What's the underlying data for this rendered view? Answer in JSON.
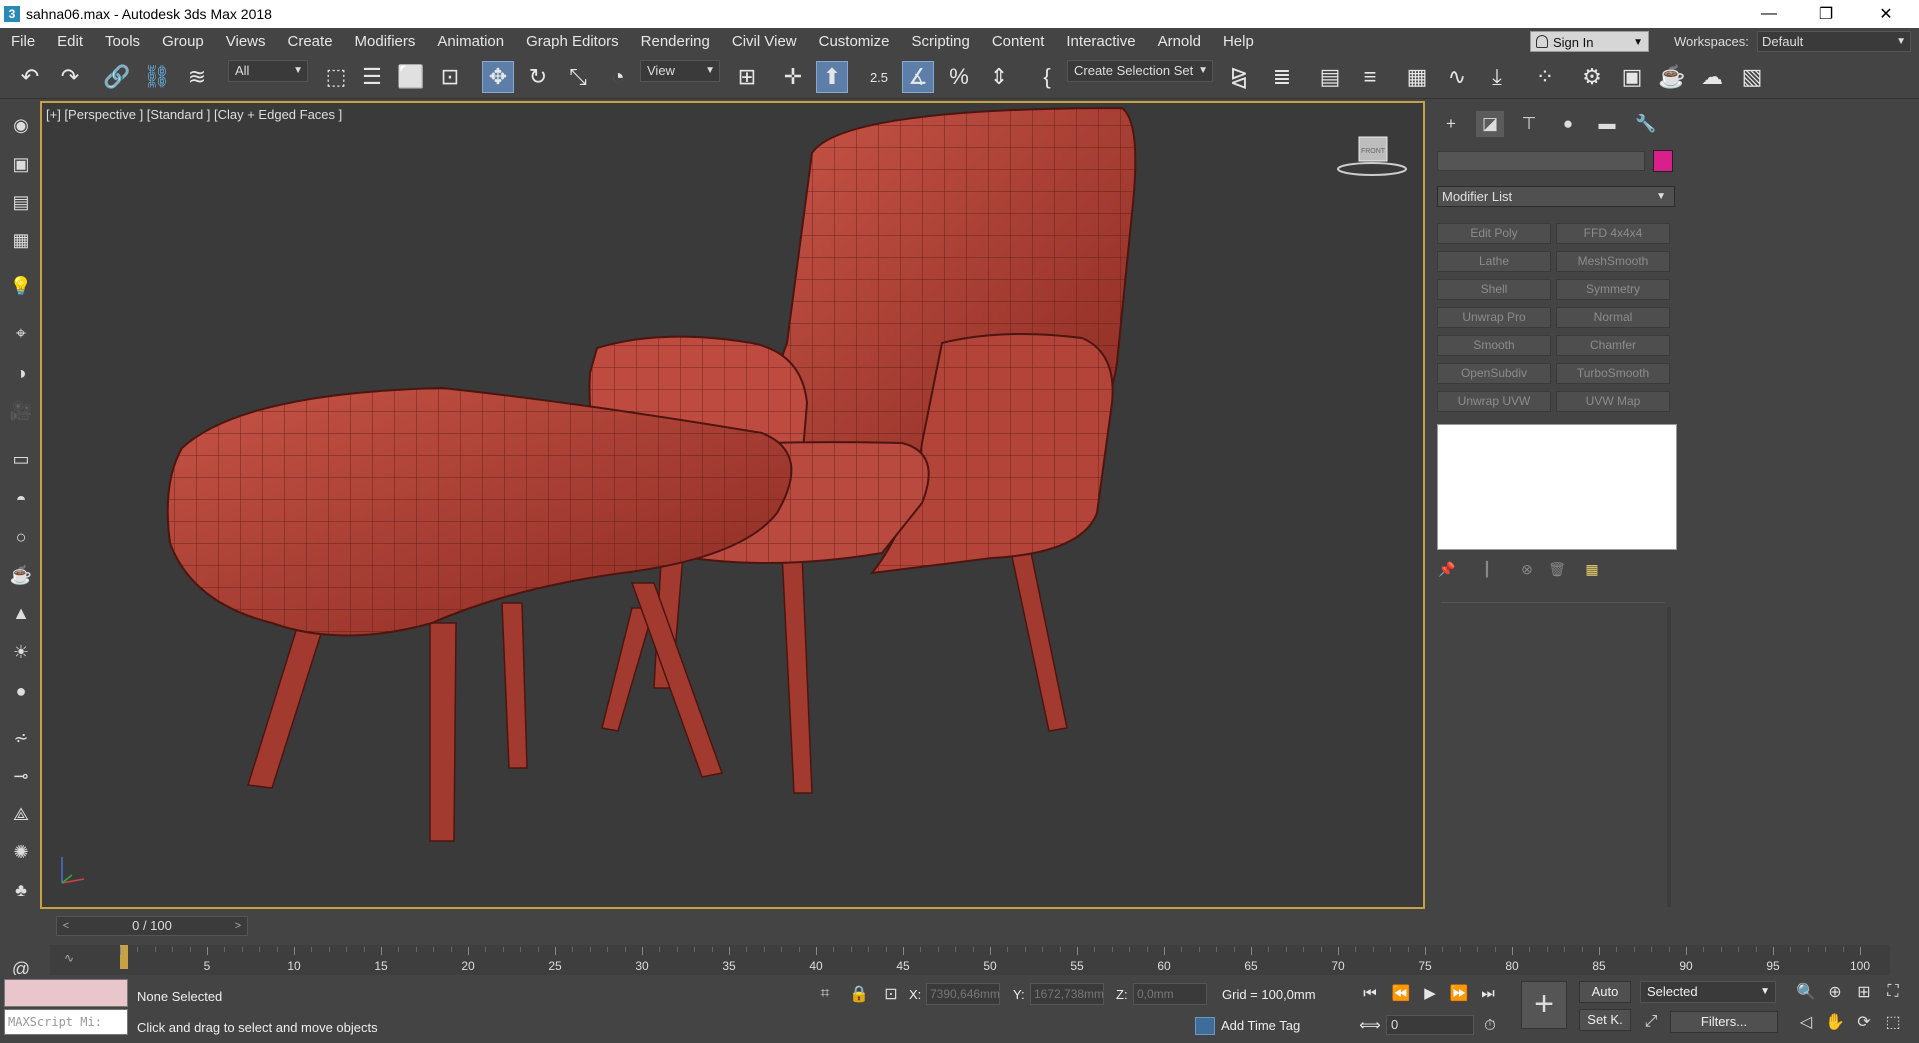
{
  "window": {
    "title": "sahna06.max - Autodesk 3ds Max 2018",
    "app_icon": "3",
    "minimize": "—",
    "maximize": "❐",
    "close": "✕"
  },
  "menu": [
    "File",
    "Edit",
    "Tools",
    "Group",
    "Views",
    "Create",
    "Modifiers",
    "Animation",
    "Graph Editors",
    "Rendering",
    "Civil View",
    "Customize",
    "Scripting",
    "Content",
    "Interactive",
    "Arnold",
    "Help"
  ],
  "account": {
    "sign_in": "Sign In",
    "workspaces_label": "Workspaces:",
    "workspace_value": "Default"
  },
  "toolbar": {
    "selection_filter": "All",
    "ref_coord": "View",
    "selection_set": "Create Selection Set",
    "snap_label": "2.5",
    "percent_label": "%"
  },
  "viewport": {
    "label": "[+] [Perspective ] [Standard ] [Clay + Edged Faces ]",
    "viewcube_text": "FRONT",
    "colors": {
      "border": "#c8a046",
      "mesh": "#b8463c",
      "bg": "#3a3a3a"
    }
  },
  "command_panel": {
    "tabs": [
      "create-icon",
      "modify-icon",
      "hierarchy-icon",
      "motion-icon",
      "display-icon",
      "utilities-icon"
    ],
    "object_name": "",
    "object_color": "#d81f8a",
    "modifier_list": "Modifier List",
    "modifier_buttons": [
      "Edit Poly",
      "FFD 4x4x4",
      "Lathe",
      "MeshSmooth",
      "Shell",
      "Symmetry",
      "Unwrap Pro",
      "Normal",
      "Smooth",
      "Chamfer",
      "OpenSubdiv",
      "TurboSmooth",
      "Unwrap UVW",
      "UVW Map"
    ]
  },
  "time_slider": {
    "label": "0 / 100",
    "prev": "<",
    "next": ">"
  },
  "trackbar": {
    "ticks": [
      "5",
      "10",
      "15",
      "20",
      "25",
      "30",
      "35",
      "40",
      "45",
      "50",
      "55",
      "60",
      "65",
      "70",
      "75",
      "80",
      "85",
      "90",
      "95",
      "100"
    ]
  },
  "status": {
    "maxscript_placeholder": "MAXScript Mi:",
    "selection": "None Selected",
    "prompt": "Click and drag to select and move objects",
    "x_label": "X:",
    "x_value": "7390,646mm",
    "y_label": "Y:",
    "y_value": "1672,738mm",
    "z_label": "Z:",
    "z_value": "0,0mm",
    "grid": "Grid = 100,0mm",
    "add_time_tag": "Add Time Tag",
    "frame": "0",
    "auto": "Auto",
    "set_key": "Set K.",
    "key_filter": "Selected",
    "filters": "Filters..."
  }
}
